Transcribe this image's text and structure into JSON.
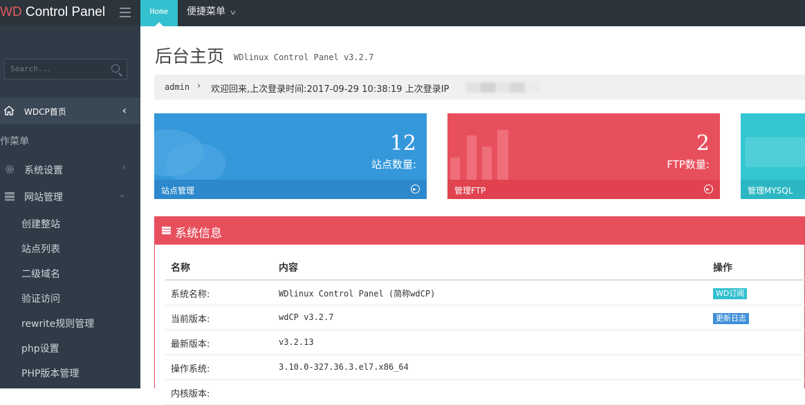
{
  "app": {
    "brand_prefix": "WD",
    "brand_suffix": " Control Panel"
  },
  "topbar": {
    "home_tab": "Home",
    "quick_menu": "便捷菜单"
  },
  "sidebar": {
    "search_placeholder": "Search...",
    "active_item": "WDCP首页",
    "section_title": "作菜单",
    "items": [
      {
        "label": "系统设置",
        "icon": "gear-icon"
      },
      {
        "label": "网站管理",
        "icon": "server-icon"
      }
    ],
    "sub_items": [
      "创建整站",
      "站点列表",
      "二级域名",
      "验证访问",
      "rewrite规则管理",
      "php设置",
      "PHP版本管理"
    ]
  },
  "main": {
    "title": "后台主页",
    "subtitle": "WDlinux Control Panel v3.2.7",
    "breadcrumb": {
      "user": "admin",
      "separator": "›",
      "message": "欢迎回来,上次登录时间:2017-09-29 10:38:19 上次登录IP"
    },
    "cards": [
      {
        "value": "12",
        "caption": "站点数量:",
        "footer": "站点管理",
        "color": "#3498db"
      },
      {
        "value": "2",
        "caption": "FTP数量:",
        "footer": "管理FTP",
        "color": "#e84f5d"
      },
      {
        "value": "",
        "caption": "",
        "footer": "管理MYSQL",
        "color": "#33c6d1"
      }
    ],
    "sysinfo": {
      "title": "系统信息",
      "headers": {
        "name": "名称",
        "content": "内容",
        "action": "操作"
      },
      "rows": [
        {
          "name": "系统名称:",
          "content": "WDlinux Control Panel (简称wdCP)",
          "action": "WD订阅",
          "action_color": "#33c0cf"
        },
        {
          "name": "当前版本:",
          "content": "wdCP v3.2.7",
          "action": "更新日志",
          "action_color": "#3f8fd8"
        },
        {
          "name": "最新版本:",
          "content": "v3.2.13",
          "action": ""
        },
        {
          "name": "操作系统:",
          "content": "3.10.0-327.36.3.el7.x86_64",
          "action": ""
        },
        {
          "name": "内核版本:",
          "content": "",
          "action": ""
        }
      ]
    }
  }
}
